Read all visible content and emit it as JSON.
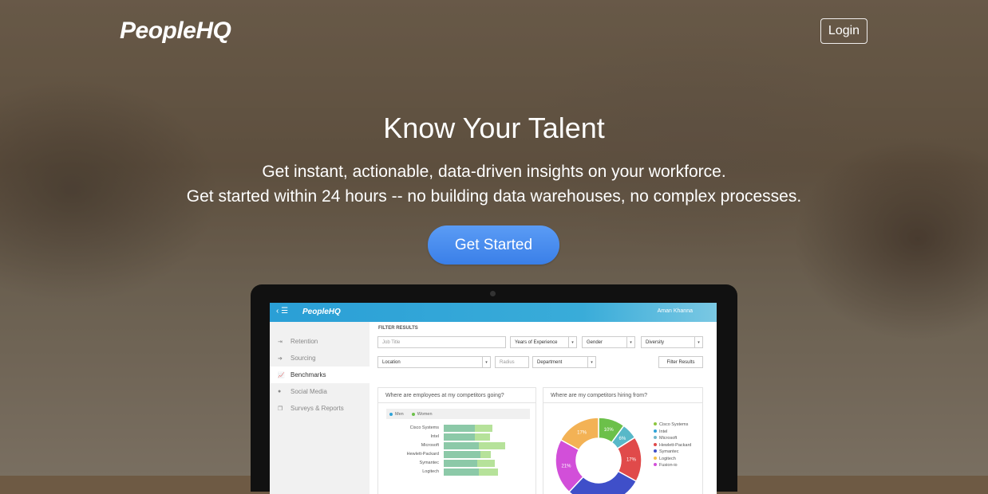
{
  "brand": {
    "logo": "PeopleHQ"
  },
  "nav": {
    "login_label": "Login"
  },
  "hero": {
    "headline": "Know Your Talent",
    "sub1": "Get instant, actionable, data-driven insights on your workforce.",
    "sub2": "Get started within 24 hours -- no building data warehouses, no complex processes.",
    "cta_label": "Get Started"
  },
  "app": {
    "logo": "PeopleHQ",
    "user": "Aman Khanna",
    "sidebar": [
      {
        "label": "Retention",
        "icon": "retention-icon",
        "active": false
      },
      {
        "label": "Sourcing",
        "icon": "sourcing-icon",
        "active": false
      },
      {
        "label": "Benchmarks",
        "icon": "benchmarks-icon",
        "active": true
      },
      {
        "label": "Social Media",
        "icon": "social-media-icon",
        "active": false
      },
      {
        "label": "Surveys & Reports",
        "icon": "surveys-icon",
        "active": false
      }
    ],
    "filter": {
      "title": "FILTER RESULTS",
      "job_title_placeholder": "Job Title",
      "experience": "Years of Experience",
      "gender": "Gender",
      "diversity": "Diversity",
      "location": "Location",
      "radius_placeholder": "Radius",
      "department": "Department",
      "button": "Filter Results"
    },
    "panel_left": {
      "title": "Where are employees at my competitors going?",
      "legend": [
        "Men",
        "Women"
      ],
      "colors": {
        "men": "#8cc9a8",
        "women": "#b6e29a"
      },
      "companies": [
        "Cisco Systems",
        "Intel",
        "Microsoft",
        "Hewlett-Packard",
        "Symantec",
        "Logitech"
      ],
      "men": [
        0.35,
        0.35,
        0.4,
        0.42,
        0.38,
        0.4
      ],
      "women": [
        0.2,
        0.18,
        0.3,
        0.12,
        0.2,
        0.22
      ]
    },
    "panel_right": {
      "title": "Where are my competitors hiring from?",
      "legend": [
        "Cisco Systems",
        "Intel",
        "Microsoft",
        "Hewlett-Packard",
        "Symantec",
        "Logitech",
        "Fusion-io"
      ],
      "legend_colors": [
        "#8cc63f",
        "#2ea3d8",
        "#6fb7c9",
        "#e04a4a",
        "#3f4fc9",
        "#f3c14a",
        "#d24fd9"
      ],
      "slices": [
        {
          "label": "10%",
          "value": 10,
          "color": "#6cc04a"
        },
        {
          "label": "6%",
          "value": 6,
          "color": "#58b8c8"
        },
        {
          "label": "17%",
          "value": 17,
          "color": "#e04a4a"
        },
        {
          "label": "",
          "value": 29,
          "color": "#3f4fc9"
        },
        {
          "label": "21%",
          "value": 21,
          "color": "#d24fd9"
        },
        {
          "label": "17%",
          "value": 17,
          "color": "#f3b255"
        }
      ]
    }
  }
}
